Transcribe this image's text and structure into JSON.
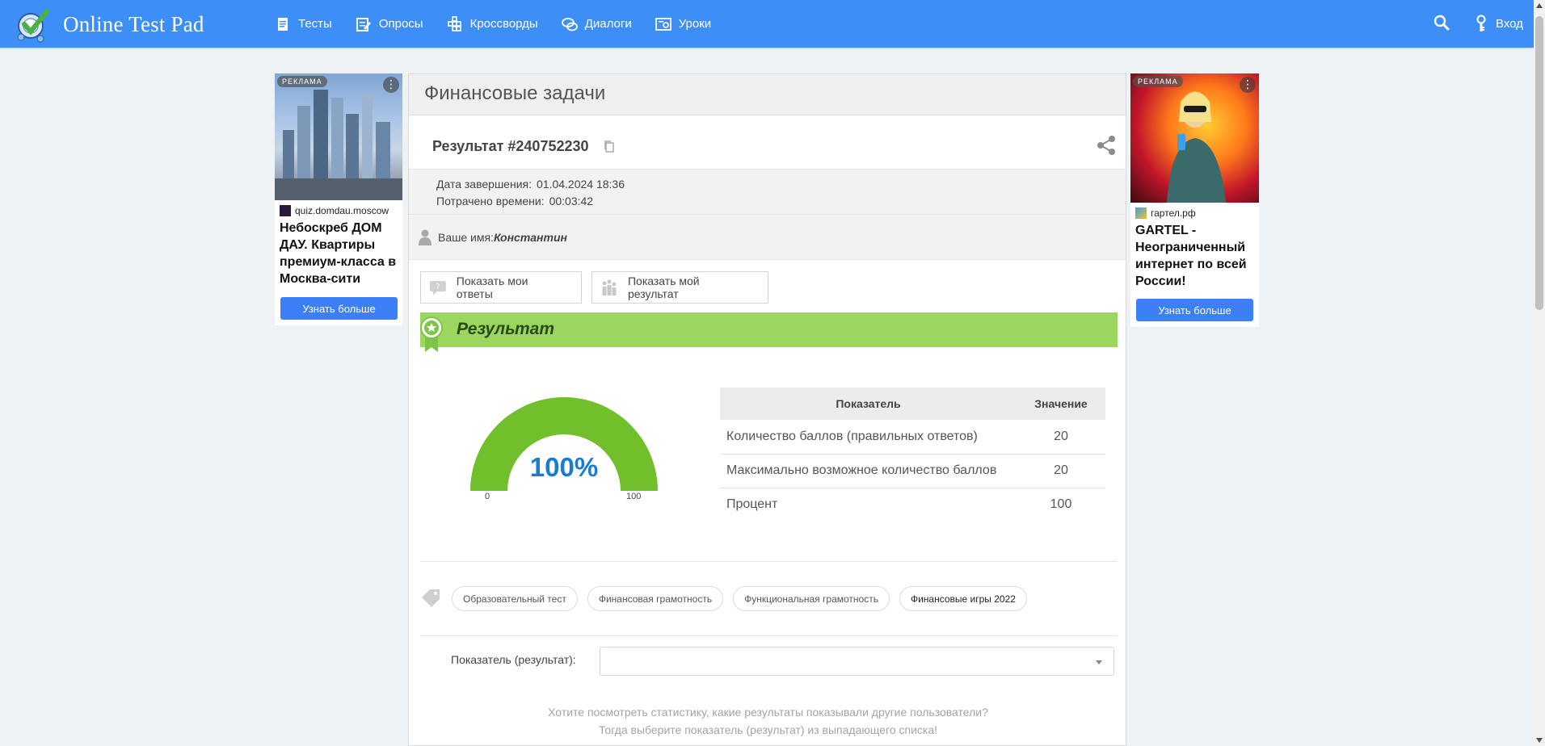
{
  "header": {
    "logo_text": "Online Test Pad",
    "nav": [
      {
        "label": "Тесты",
        "icon": "document-icon"
      },
      {
        "label": "Опросы",
        "icon": "survey-icon"
      },
      {
        "label": "Кроссворды",
        "icon": "crossword-icon"
      },
      {
        "label": "Диалоги",
        "icon": "chat-icon"
      },
      {
        "label": "Уроки",
        "icon": "lesson-icon"
      }
    ],
    "login_label": "Вход"
  },
  "ads": {
    "left": {
      "label": "РЕКЛАМА",
      "source": "quiz.domdau.moscow",
      "title": "Небоскреб ДОМ ДАУ. Квартиры премиум-класса в Москва-сити",
      "button": "Узнать больше"
    },
    "right": {
      "label": "РЕКЛАМА",
      "source": "гартел.рф",
      "title": "GARTEL - Неограниченный интернет по всей России!",
      "button": "Узнать больше"
    }
  },
  "panel": {
    "title": "Финансовые задачи",
    "result_title": "Результат #240752230",
    "finish_label": "Дата завершения:",
    "finish_value": "01.04.2024 18:36",
    "time_label": "Потрачено времени:",
    "time_value": "00:03:42",
    "name_label": "Ваше имя:",
    "name_value": "Константин",
    "btn_answers": "Показать мои ответы",
    "btn_result": "Показать мой результат",
    "result_heading": "Результат",
    "gauge": {
      "percent_text": "100%",
      "value": 100,
      "min": "0",
      "max": "100"
    },
    "table": {
      "headers": [
        "Показатель",
        "Значение"
      ],
      "rows": [
        [
          "Количество баллов (правильных ответов)",
          "20"
        ],
        [
          "Максимально возможное количество баллов",
          "20"
        ],
        [
          "Процент",
          "100"
        ]
      ]
    },
    "tags": [
      "Образовательный тест",
      "Финансовая грамотность",
      "Функциональная грамотность",
      "Финансовые игры 2022"
    ],
    "indicator_label": "Показатель (результат):",
    "select_value": "",
    "hint_line1": "Хотите посмотреть статистику, какие результаты показывали другие пользователи?",
    "hint_line2": "Тогда выберите показатель (результат) из выпадающего списка!"
  },
  "colors": {
    "header": "#3e8ef7",
    "result_bar": "#9bd75e",
    "gauge_fill": "#70bf2b",
    "percent_text": "#1a7bd4",
    "ad_button": "#3d7ff6"
  }
}
